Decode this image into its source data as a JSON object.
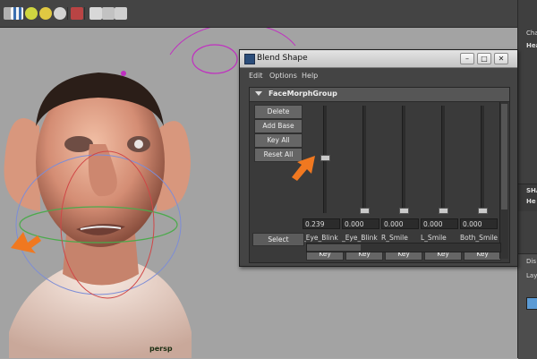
{
  "viewport": {
    "camera_label": "persp"
  },
  "blend_shape_window": {
    "title": "Blend Shape",
    "menus": [
      "Edit",
      "Options",
      "Help"
    ],
    "group_name": "FaceMorphGroup",
    "side_buttons": [
      "Delete",
      "Add Base",
      "Key All",
      "Reset All"
    ],
    "select_label": "Select",
    "key_label": "Key",
    "targets": [
      {
        "name": "L_Eye_Blink",
        "display_name": "_Eye_Blink",
        "value": "0.239",
        "weight": 0.239
      },
      {
        "name": "R_Eye_Blink",
        "display_name": "_Eye_Blink",
        "value": "0.000",
        "weight": 0.0
      },
      {
        "name": "R_Smile",
        "display_name": "R_Smile",
        "value": "0.000",
        "weight": 0.0
      },
      {
        "name": "L_Smile",
        "display_name": "L_Smile",
        "value": "0.000",
        "weight": 0.0
      },
      {
        "name": "Both_Smile",
        "display_name": "Both_Smile",
        "value": "0.000",
        "weight": 0.0
      }
    ]
  },
  "right_panel": {
    "labels": [
      "Cha",
      "Hea",
      "SHA",
      "He",
      "Dis",
      "Lay"
    ]
  },
  "colors": {
    "annotation_arrow": "#f07820",
    "ui_dark": "#444444",
    "viewport_bg": "#a3a3a3"
  }
}
